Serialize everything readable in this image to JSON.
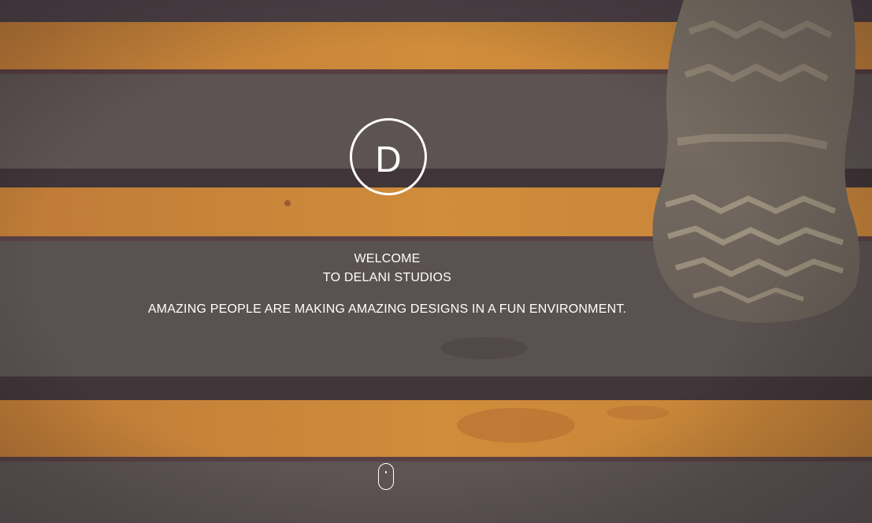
{
  "hero": {
    "logo_letter": "D",
    "welcome_line": "WELCOME",
    "studio_line": "TO DELANI STUDIOS",
    "tagline": "AMAZING PEOPLE ARE MAKING AMAZING DESIGNS IN A FUN ENVIRONMENT.",
    "scroll_icon": "mouse-scroll-icon"
  },
  "colors": {
    "text": "#ffffff",
    "stripe_orange": "#e8962f",
    "step_gray": "#5e5753",
    "overlay": "#4a3a44"
  }
}
